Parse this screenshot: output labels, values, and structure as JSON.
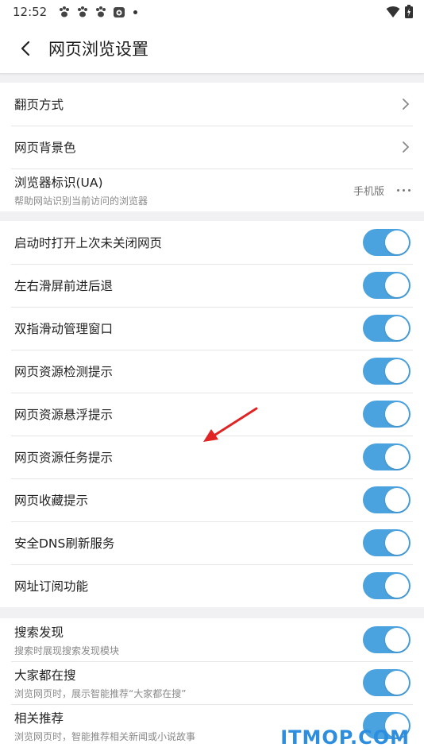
{
  "status_bar": {
    "time": "12:52"
  },
  "header": {
    "title": "网页浏览设置"
  },
  "section1": {
    "items": [
      {
        "label": "翻页方式"
      },
      {
        "label": "网页背景色"
      },
      {
        "label": "浏览器标识(UA)",
        "sub": "帮助网站识别当前访问的浏览器",
        "value": "手机版"
      }
    ]
  },
  "section2": {
    "items": [
      {
        "label": "启动时打开上次未关闭网页",
        "on": true
      },
      {
        "label": "左右滑屏前进后退",
        "on": true
      },
      {
        "label": "双指滑动管理窗口",
        "on": true
      },
      {
        "label": "网页资源检测提示",
        "on": true
      },
      {
        "label": "网页资源悬浮提示",
        "on": true
      },
      {
        "label": "网页资源任务提示",
        "on": true
      },
      {
        "label": "网页收藏提示",
        "on": true
      },
      {
        "label": "安全DNS刷新服务",
        "on": true
      },
      {
        "label": "网址订阅功能",
        "on": true
      }
    ]
  },
  "section3": {
    "items": [
      {
        "label": "搜索发现",
        "sub": "搜索时展现搜索发现模块",
        "on": true
      },
      {
        "label": "大家都在搜",
        "sub": "浏览网页时，展示智能推荐“大家都在搜”",
        "on": true
      },
      {
        "label": "相关推荐",
        "sub": "浏览网页时，智能推荐相关新闻或小说故事",
        "on": true
      }
    ]
  },
  "watermark": "ITMOP.COM",
  "colors": {
    "accent": "#4aa2df",
    "annotation_arrow": "#e02424"
  }
}
